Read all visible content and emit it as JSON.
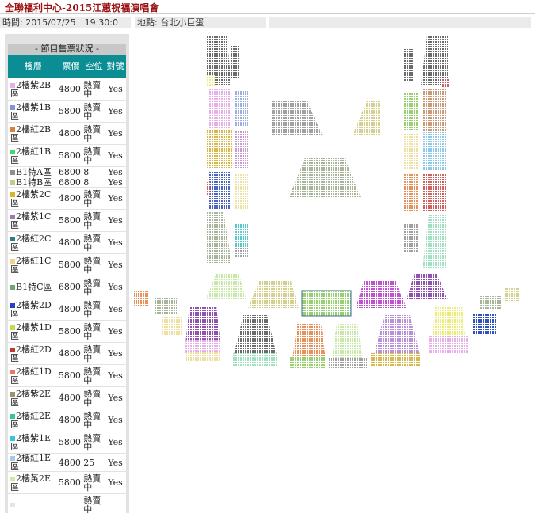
{
  "title": "全聯福利中心-2015江蕙祝福演唱會",
  "info": {
    "time_label": "時間: 2015/07/25　19:30:0",
    "venue_label": "地點: 台北小巨蛋"
  },
  "sidebar": {
    "heading": "- 節目售票狀況 -",
    "columns": [
      "樓層",
      "票價",
      "空位",
      "對號"
    ],
    "rows": [
      {
        "area": "2樓紫2B區",
        "price": "4800",
        "seats": "熱賣中",
        "assigned": "Yes",
        "color": "#e8aee8"
      },
      {
        "area": "2樓紫1B區",
        "price": "5800",
        "seats": "熱賣中",
        "assigned": "Yes",
        "color": "#7f95d6"
      },
      {
        "area": "2樓紅2B區",
        "price": "4800",
        "seats": "熱賣中",
        "assigned": "Yes",
        "color": "#d9803a"
      },
      {
        "area": "2樓紅1B區",
        "price": "5800",
        "seats": "熱賣中",
        "assigned": "Yes",
        "color": "#42d96e"
      },
      {
        "area": "B1特A區",
        "price": "6800",
        "seats": "8",
        "assigned": "Yes",
        "color": "#8f9186"
      },
      {
        "area": "B1特B區",
        "price": "6800",
        "seats": "8",
        "assigned": "Yes",
        "color": "#c6c98c"
      },
      {
        "area": "2樓紫2C區",
        "price": "4800",
        "seats": "熱賣中",
        "assigned": "Yes",
        "color": "#d4b62a"
      },
      {
        "area": "2樓紫1C區",
        "price": "5800",
        "seats": "熱賣中",
        "assigned": "Yes",
        "color": "#a374b3"
      },
      {
        "area": "2樓紅2C區",
        "price": "4800",
        "seats": "熱賣中",
        "assigned": "Yes",
        "color": "#2e7c8c"
      },
      {
        "area": "2樓紅1C區",
        "price": "5800",
        "seats": "熱賣中",
        "assigned": "Yes",
        "color": "#eed592"
      },
      {
        "area": "B1特C區",
        "price": "6800",
        "seats": "熱賣中",
        "assigned": "Yes",
        "color": "#6fa66f"
      },
      {
        "area": "2樓紫2D區",
        "price": "4800",
        "seats": "熱賣中",
        "assigned": "Yes",
        "color": "#2841c4"
      },
      {
        "area": "2樓紫1D區",
        "price": "5800",
        "seats": "熱賣中",
        "assigned": "Yes",
        "color": "#c4dc54"
      },
      {
        "area": "2樓紅2D區",
        "price": "4800",
        "seats": "熱賣中",
        "assigned": "Yes",
        "color": "#c03a2a"
      },
      {
        "area": "2樓紅1D區",
        "price": "5800",
        "seats": "熱賣中",
        "assigned": "Yes",
        "color": "#ee7560"
      },
      {
        "area": "2樓紫2E區",
        "price": "4800",
        "seats": "熱賣中",
        "assigned": "Yes",
        "color": "#9a9472"
      },
      {
        "area": "2樓紅2E區",
        "price": "4800",
        "seats": "熱賣中",
        "assigned": "Yes",
        "color": "#36c4a0"
      },
      {
        "area": "2樓紫1E區",
        "price": "5800",
        "seats": "熱賣中",
        "assigned": "Yes",
        "color": "#38c4dc"
      },
      {
        "area": "2樓紅1E區",
        "price": "4800",
        "seats": "25",
        "assigned": "Yes",
        "color": "#a9c8e8"
      },
      {
        "area": "2樓黃2E區",
        "price": "5800",
        "seats": "熱賣中",
        "assigned": "Yes",
        "color": "#cde8a8"
      },
      {
        "area": "",
        "price": "",
        "seats": "熱賣中",
        "assigned": "",
        "color": "#e4e4e4"
      }
    ]
  },
  "colors": {
    "dark": "#6a6a6a",
    "pink": "#e8aee8",
    "plum": "#c69ad0",
    "periwinkle": "#9aaee0",
    "navy": "#4a64c0",
    "mustard": "#d8b84a",
    "cream": "#eee0a0",
    "olive": "#b8bb6e",
    "sage": "#a7b49a",
    "mint": "#9ee0c0",
    "teal": "#56c8c8",
    "lime": "#98d070",
    "brown": "#c99a78",
    "orange": "#e8905a",
    "red": "#d06060",
    "skyblue": "#8ec8e8",
    "khaki": "#d4cf8c",
    "lavender": "#b890d8",
    "magenta": "#c050d0",
    "purple": "#9050b0",
    "lightgreen": "#c8e8a8",
    "yellow": "#ecec70",
    "gray": "#a0a0a0",
    "blue": "#3050c0"
  }
}
